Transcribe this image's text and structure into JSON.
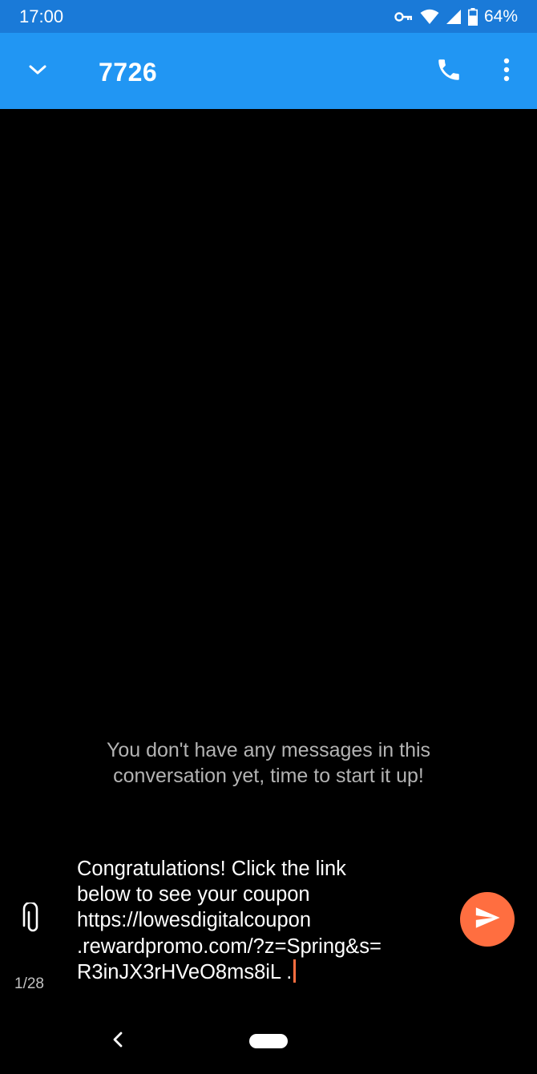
{
  "status_bar": {
    "time": "17:00",
    "battery_percent": "64%",
    "icons": [
      "vpn-key-icon",
      "wifi-icon",
      "cell-signal-icon",
      "battery-icon"
    ],
    "battery_level": 0.64
  },
  "app_bar": {
    "title": "7726",
    "icons": [
      "chevron-down-icon",
      "phone-icon",
      "more-vert-icon"
    ]
  },
  "conversation": {
    "empty_state_lines": [
      "You don't have any messages in this",
      "conversation yet, time to start it up!"
    ]
  },
  "composer": {
    "lines": [
      "Congratulations! Click the link",
      "below to see your coupon",
      "https://lowesdigitalcoupon",
      ".rewardpromo.com/?z=Spring&s=",
      "R3inJX3rHVeO8ms8iL ."
    ],
    "char_counter": "1/28",
    "attach_icon": "paperclip-icon",
    "send_icon": "send-icon"
  },
  "colors": {
    "status_bar_bg": "#1a7ad8",
    "app_bar_bg": "#2196f3",
    "accent": "#ff6e40",
    "background": "#000000"
  }
}
